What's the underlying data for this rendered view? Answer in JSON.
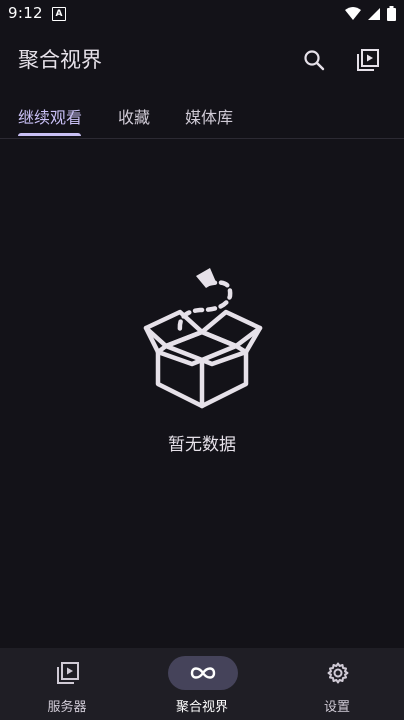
{
  "status_bar": {
    "time": "9:12",
    "notification_letter": "A"
  },
  "app_bar": {
    "title": "聚合视界",
    "search_icon": "search-icon",
    "library_icon": "video-library-icon"
  },
  "tabs": [
    {
      "label": "继续观看",
      "active": true
    },
    {
      "label": "收藏",
      "active": false
    },
    {
      "label": "媒体库",
      "active": false
    }
  ],
  "empty_state": {
    "message": "暂无数据",
    "icon": "empty-box-icon"
  },
  "bottom_nav": [
    {
      "label": "服务器",
      "icon": "video-library-icon",
      "active": false
    },
    {
      "label": "聚合视界",
      "icon": "infinity-icon",
      "active": true
    },
    {
      "label": "设置",
      "icon": "gear-icon",
      "active": false
    }
  ],
  "colors": {
    "background": "#131218",
    "accent": "#c9c0f5",
    "nav_background": "#1f1e25",
    "active_pill": "#45435a"
  }
}
